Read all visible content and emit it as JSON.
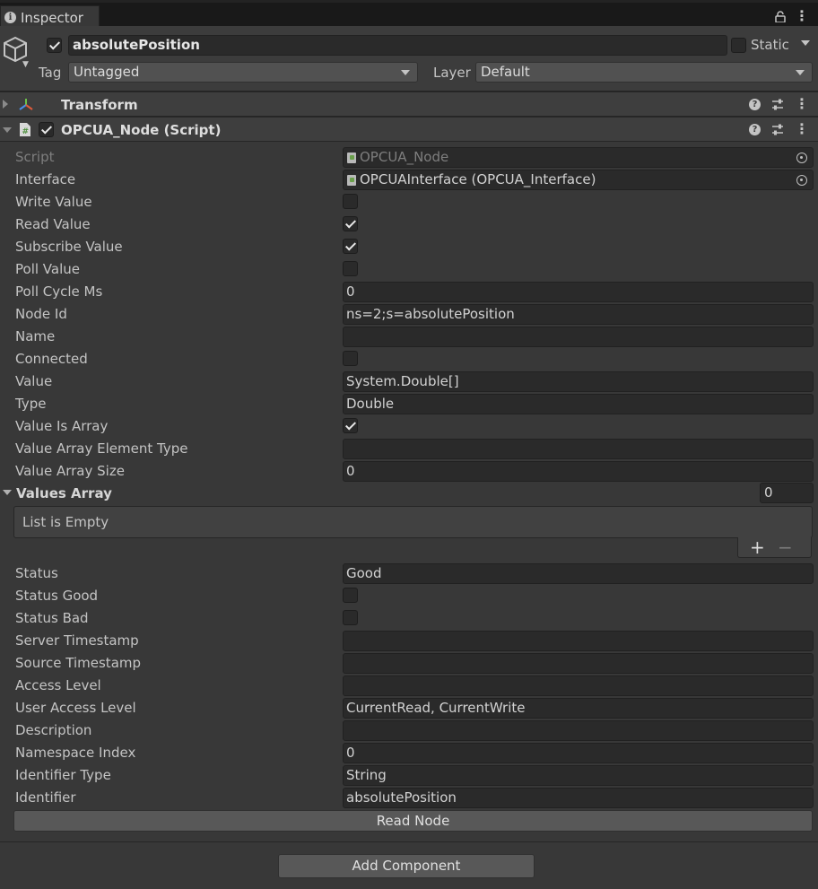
{
  "tab": {
    "title": "Inspector"
  },
  "gameobject": {
    "name": "absolutePosition",
    "active": true,
    "static_label": "Static",
    "static_checked": false,
    "tag_label": "Tag",
    "tag_value": "Untagged",
    "layer_label": "Layer",
    "layer_value": "Default"
  },
  "components": {
    "transform": {
      "title": "Transform"
    },
    "script": {
      "title": "OPCUA_Node (Script)",
      "enabled": true
    }
  },
  "properties": {
    "script": {
      "label": "Script",
      "value": "OPCUA_Node"
    },
    "interface": {
      "label": "Interface",
      "value": "OPCUAInterface (OPCUA_Interface)"
    },
    "write_value": {
      "label": "Write Value",
      "checked": false
    },
    "read_value": {
      "label": "Read Value",
      "checked": true
    },
    "subscribe_value": {
      "label": "Subscribe Value",
      "checked": true
    },
    "poll_value": {
      "label": "Poll Value",
      "checked": false
    },
    "poll_cycle_ms": {
      "label": "Poll Cycle Ms",
      "value": "0"
    },
    "node_id": {
      "label": "Node Id",
      "value": "ns=2;s=absolutePosition"
    },
    "name": {
      "label": "Name",
      "value": ""
    },
    "connected": {
      "label": "Connected",
      "checked": false
    },
    "value": {
      "label": "Value",
      "value": "System.Double[]"
    },
    "type": {
      "label": "Type",
      "value": "Double"
    },
    "value_is_array": {
      "label": "Value Is Array",
      "checked": true
    },
    "value_array_element_type": {
      "label": "Value Array Element Type",
      "value": ""
    },
    "value_array_size": {
      "label": "Value Array Size",
      "value": "0"
    },
    "values_array": {
      "label": "Values Array",
      "size": "0",
      "empty_text": "List is Empty",
      "add": "+",
      "remove": "−"
    },
    "status": {
      "label": "Status",
      "value": "Good"
    },
    "status_good": {
      "label": "Status Good",
      "checked": false
    },
    "status_bad": {
      "label": "Status Bad",
      "checked": false
    },
    "server_timestamp": {
      "label": "Server Timestamp",
      "value": ""
    },
    "source_timestamp": {
      "label": "Source Timestamp",
      "value": ""
    },
    "access_level": {
      "label": "Access Level",
      "value": ""
    },
    "user_access_level": {
      "label": "User Access Level",
      "value": "CurrentRead, CurrentWrite"
    },
    "description": {
      "label": "Description",
      "value": ""
    },
    "namespace_index": {
      "label": "Namespace Index",
      "value": "0"
    },
    "identifier_type": {
      "label": "Identifier Type",
      "value": "String"
    },
    "identifier": {
      "label": "Identifier",
      "value": "absolutePosition"
    }
  },
  "buttons": {
    "read_node": "Read Node",
    "add_component": "Add Component"
  }
}
